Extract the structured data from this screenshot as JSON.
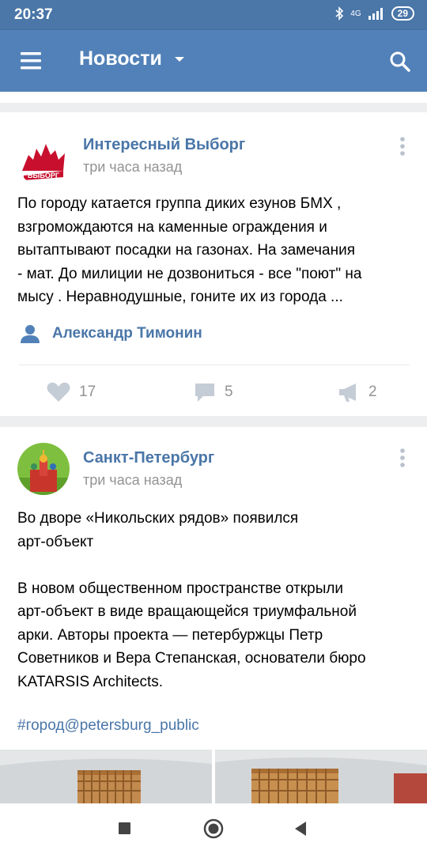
{
  "status_bar": {
    "time": "20:37",
    "network": "4G",
    "battery": "29"
  },
  "toolbar": {
    "title": "Новости"
  },
  "posts": [
    {
      "author": "Интересный Выборг",
      "time": "три часа назад",
      "avatar_text": "ВЫБОРГ",
      "text_lines": [
        "По городу катается группа диких езунов БМХ ,",
        "взгромождаются на каменные ограждения и",
        "вытаптывают посадки на газонах. На замечания",
        "- мат. До милиции не дозвониться - все \"поют\" на",
        "мысу . Неравнодушные, гоните их из города ..."
      ],
      "signer": "Александр Тимонин",
      "likes": "17",
      "comments": "5",
      "reposts": "2"
    },
    {
      "author": "Санкт-Петербург",
      "time": "три часа назад",
      "text_lines": [
        "Во дворе «Никольских рядов» появился",
        "арт-объект",
        "",
        "В новом общественном пространстве открыли",
        "арт-объект в виде вращающейся триумфальной",
        "арки. Авторы проекта — петербуржцы Петр",
        "Советников и Вера Степанская, основатели бюро",
        "KATARSIS Architects."
      ],
      "hashtag": "#город@petersburg_public"
    }
  ],
  "colors": {
    "header": "#5181b8",
    "status": "#4a76a8",
    "link": "#4a76a8",
    "muted": "#939393",
    "background": "#edeef0"
  },
  "icons": [
    "hamburger-menu-icon",
    "chevron-down-icon",
    "search-icon",
    "more-vertical-icon",
    "person-icon",
    "heart-icon",
    "comment-icon",
    "share-icon",
    "nav-square-icon",
    "nav-circle-icon",
    "nav-back-icon"
  ]
}
